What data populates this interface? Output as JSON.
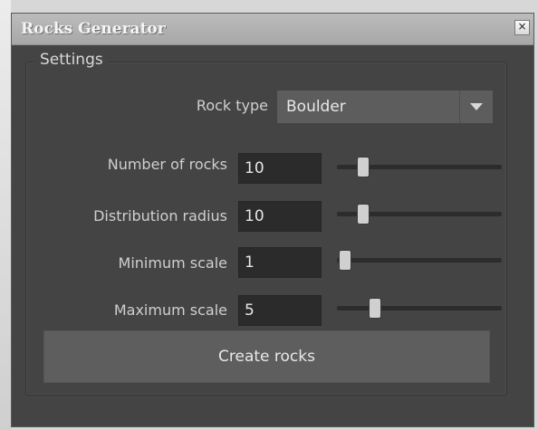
{
  "window": {
    "title": "Rocks Generator",
    "close_glyph": "×"
  },
  "settings": {
    "group_label": "Settings",
    "rock_type": {
      "label": "Rock type",
      "value": "Boulder",
      "icon": "chevron-down-icon"
    },
    "number_of_rocks": {
      "label": "Number of rocks",
      "value": "10",
      "slider_fraction": 0.12
    },
    "distribution_radius": {
      "label": "Distribution radius",
      "value": "10",
      "slider_fraction": 0.12
    },
    "minimum_scale": {
      "label": "Minimum scale",
      "value": "1",
      "slider_fraction": 0.0
    },
    "maximum_scale": {
      "label": "Maximum scale",
      "value": "5",
      "slider_fraction": 0.2
    },
    "create_button_label": "Create rocks"
  },
  "colors": {
    "window_bg": "#444444",
    "titlebar": "#b0b0b0",
    "field_bg": "#2b2b2b",
    "button_bg": "#5e5e5e",
    "slider_thumb": "#d0d0d0"
  }
}
